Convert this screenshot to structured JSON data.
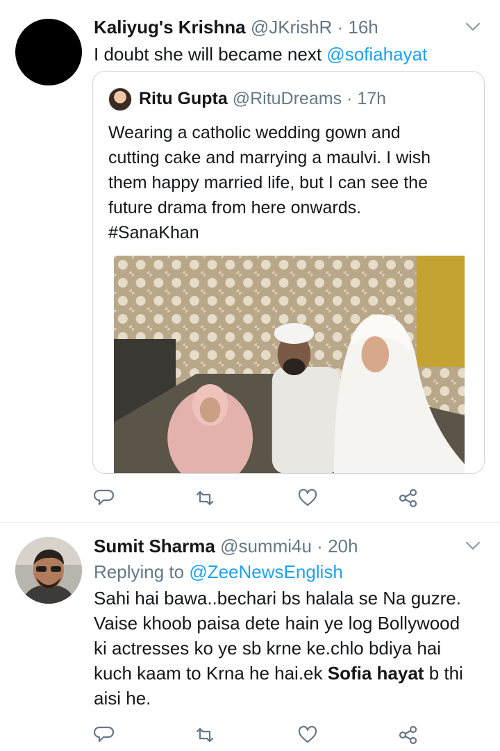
{
  "tweet1": {
    "name": "Kaliyug's Krishna",
    "handle": "@JKrishR",
    "separator": "·",
    "time": "16h",
    "text_before": "I doubt she will became next ",
    "mention": "@sofiahayat",
    "quote": {
      "name": "Ritu Gupta",
      "handle": "@RituDreams",
      "separator": "·",
      "time": "17h",
      "lines": [
        "Wearing a catholic wedding gown and",
        "cutting cake and marrying a maulvi. I wish",
        "them happy married life, but I can see the",
        "future drama from here onwards.",
        "#SanaKhan"
      ]
    }
  },
  "tweet2": {
    "name": "Sumit Sharma",
    "handle": "@summi4u",
    "separator": "·",
    "time": "20h",
    "replying_label": "Replying to ",
    "replying_to": "@ZeeNewsEnglish",
    "lines": [
      "Sahi hai bawa..bechari bs halala se Na guzre.",
      "Vaise khoob paisa dete hain ye log Bollywood",
      "ki actresses ko ye sb krne ke.chlo bdiya hai"
    ],
    "line4_before": "kuch kaam to Krna he hai.ek ",
    "line4_bold": "Sofia hayat",
    "line4_after": " b thi",
    "line5": "aisi he."
  },
  "icons": [
    "reply-icon",
    "retweet-icon",
    "like-icon",
    "share-icon",
    "chevron-down-icon"
  ],
  "colors": {
    "link": "#1da1f2",
    "secondary": "#657786",
    "border": "#ccd6dd"
  }
}
